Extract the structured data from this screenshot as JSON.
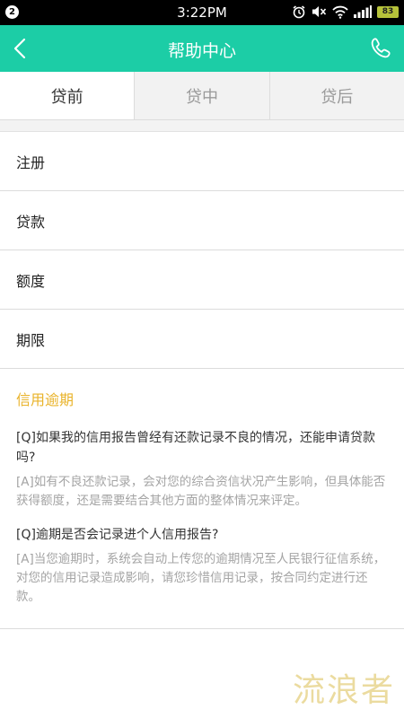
{
  "status_bar": {
    "notification_count": "2",
    "time": "3:22PM",
    "battery": "83",
    "icons": [
      "alarm-icon",
      "mute-icon",
      "wifi-icon",
      "signal-icon",
      "battery-icon"
    ]
  },
  "header": {
    "title": "帮助中心",
    "back_icon": "chevron-left-icon",
    "phone_icon": "phone-icon",
    "color": "#1ccda6"
  },
  "tabs": [
    {
      "label": "贷前",
      "active": true
    },
    {
      "label": "贷中",
      "active": false
    },
    {
      "label": "贷后",
      "active": false
    }
  ],
  "categories": [
    {
      "label": "注册"
    },
    {
      "label": "贷款"
    },
    {
      "label": "额度"
    },
    {
      "label": "期限"
    },
    {
      "label": "信用逾期",
      "active": true,
      "color": "#e9b32a"
    }
  ],
  "faqs": [
    {
      "question": "[Q]如果我的信用报告曾经有还款记录不良的情况，还能申请贷款吗?",
      "answer": "[A]如有不良还款记录，会对您的综合资信状况产生影响，但具体能否获得额度，还是需要结合其他方面的整体情况来评定。"
    },
    {
      "question": "[Q]逾期是否会记录进个人信用报告?",
      "answer": "[A]当您逾期时，系统会自动上传您的逾期情况至人民银行征信系统，对您的信用记录造成影响，请您珍惜信用记录，按合同约定进行还款。"
    }
  ],
  "watermark": "流浪者"
}
